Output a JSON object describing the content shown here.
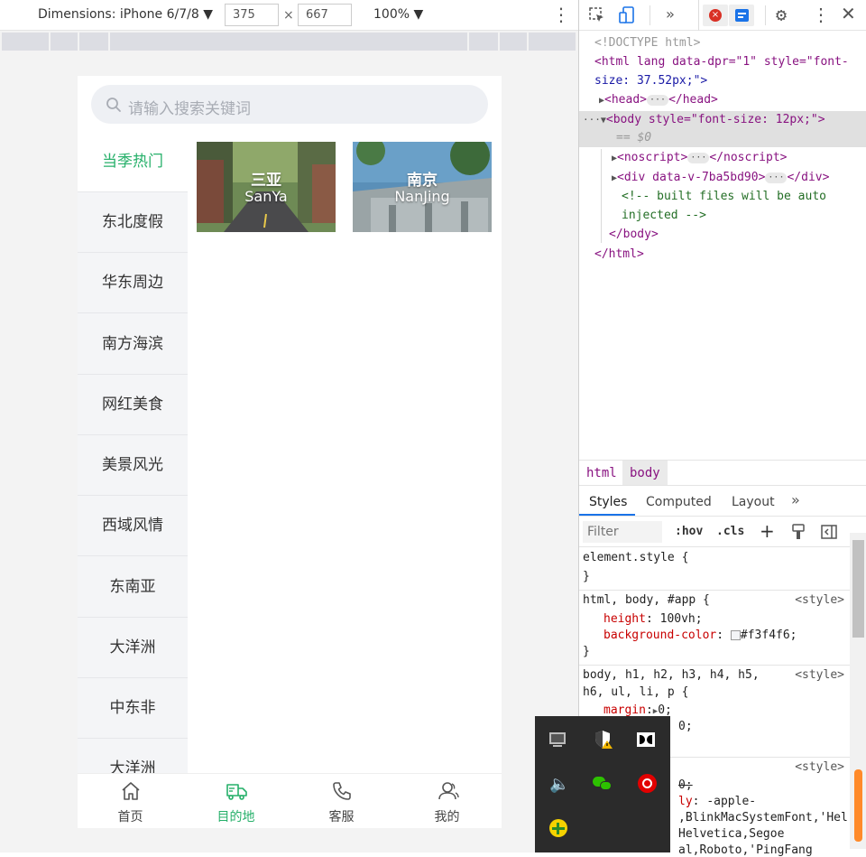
{
  "emulator": {
    "dimensions_label": "Dimensions: iPhone 6/7/8",
    "width": "375",
    "times": "×",
    "height": "667",
    "zoom": "100%"
  },
  "app": {
    "search_placeholder": "请输入搜索关键词",
    "sidebar": [
      "当季热门",
      "东北度假",
      "华东周边",
      "南方海滨",
      "网红美食",
      "美景风光",
      "西域风情",
      "东南亚",
      "大洋洲",
      "中东非",
      "大洋洲"
    ],
    "cards": [
      {
        "cn": "三亚",
        "en": "SanYa"
      },
      {
        "cn": "南京",
        "en": "NanJing"
      }
    ],
    "tabs": [
      {
        "label": "首页",
        "icon": "home-icon"
      },
      {
        "label": "目的地",
        "icon": "truck-icon",
        "active": true
      },
      {
        "label": "客服",
        "icon": "phone-icon"
      },
      {
        "label": "我的",
        "icon": "user-icon"
      }
    ],
    "accent": "#26b06a"
  },
  "devtools": {
    "dom": {
      "doctype": "<!DOCTYPE html>",
      "html_open": "<html lang data-dpr=\"1\" style=\"font-",
      "html_open_2": "size: 37.52px;\">",
      "head": "<head>",
      "head_close": "</head>",
      "body": "<body style=\"font-size: 12px;\">",
      "eq": "== $0",
      "noscript": "<noscript>",
      "noscript_close": "</noscript>",
      "div": "<div data-v-7ba5bd90>",
      "div_close": "</div>",
      "comment1": "<!-- built files will be auto",
      "comment2": "injected -->",
      "body_close": "</body>",
      "html_close": "</html>"
    },
    "breadcrumb": [
      "html",
      "body"
    ],
    "subtabs": [
      "Styles",
      "Computed",
      "Layout"
    ],
    "filter_placeholder": "Filter",
    "hov": ":hov",
    "cls": ".cls",
    "rules": {
      "r1_sel": "element.style {",
      "r1_end": "}",
      "r2_sel": "html, body, #app {",
      "r2_src": "<style>",
      "r2_p1": "height",
      "r2_v1": "100vh;",
      "r2_p2": "background-color",
      "r2_v2": "#f3f4f6;",
      "r2_end": "}",
      "r3_sel": "body, h1, h2, h3, h4, h5,",
      "r3_sel2": "h6, ul, li, p {",
      "r3_src": "<style>",
      "r3_p1": "margin",
      "r3_v1": "0;",
      "r3_v2": "0;",
      "r4_src": "<style>",
      "r4_v1": "0;",
      "r4_p2": "ly",
      "r4_v2": "-apple-",
      "r4_v3": ",BlinkMacSystemFont,'Hel",
      "r4_v4": "Helvetica,Segoe",
      "r4_v5": "al,Roboto,'PingFang"
    },
    "bg_color": "#f3f4f6"
  }
}
